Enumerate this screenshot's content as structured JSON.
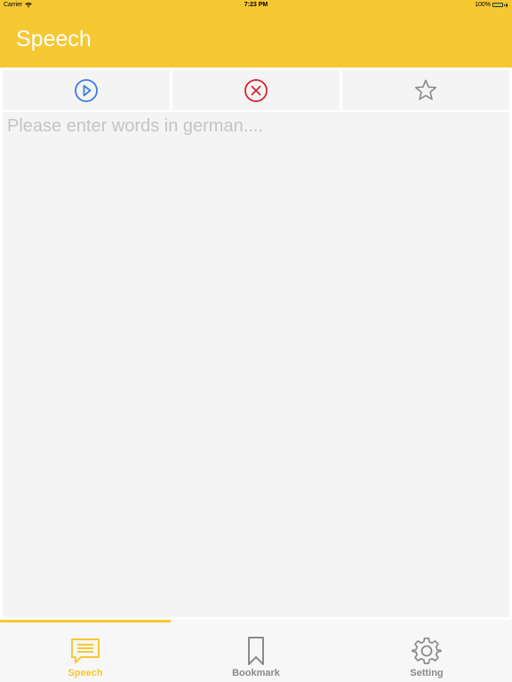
{
  "status_bar": {
    "carrier": "Carrier",
    "time": "7:23 PM",
    "battery": "100%"
  },
  "nav": {
    "title": "Speech"
  },
  "toolbar": {
    "play_icon": "play-circle-icon",
    "clear_icon": "close-circle-icon",
    "bookmark_icon": "star-icon"
  },
  "editor": {
    "placeholder": "Please enter words in german....",
    "value": ""
  },
  "tabs": [
    {
      "label": "Speech",
      "icon": "speech-bubble-icon",
      "active": true
    },
    {
      "label": "Bookmark",
      "icon": "bookmark-icon",
      "active": false
    },
    {
      "label": "Setting",
      "icon": "gear-icon",
      "active": false
    }
  ],
  "colors": {
    "accent": "#F6C832",
    "play": "#3D7BE5",
    "clear": "#D8202E",
    "inactive": "#8A8A8A"
  }
}
